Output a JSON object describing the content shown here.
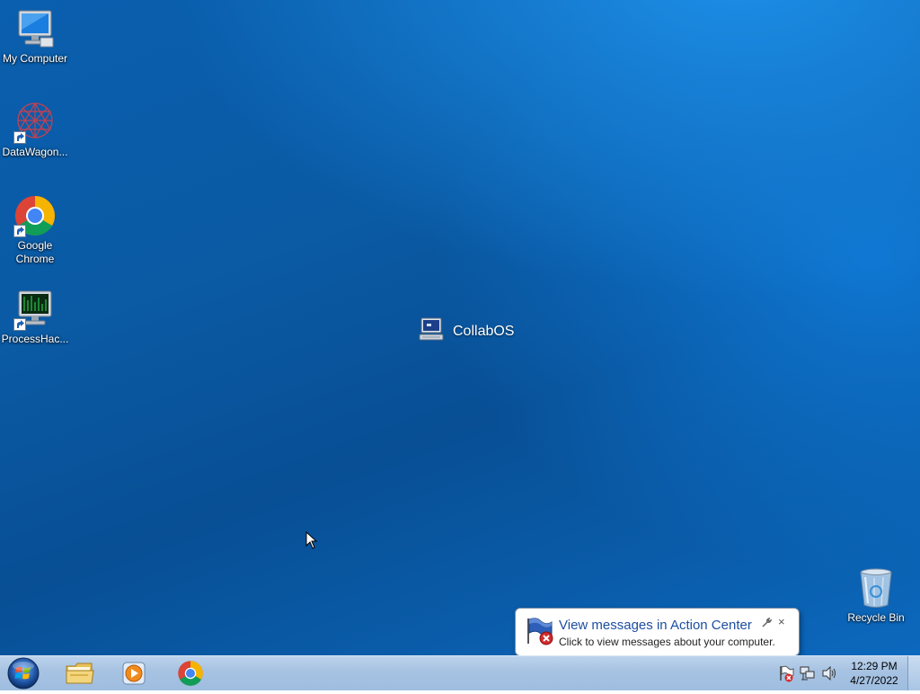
{
  "desktop": {
    "icons": [
      {
        "label": "My Computer",
        "icon": "computer-icon"
      },
      {
        "label": "DataWagon...",
        "icon": "datawagon-icon"
      },
      {
        "label": "Google Chrome",
        "icon": "chrome-icon"
      },
      {
        "label": "ProcessHac...",
        "icon": "processhacker-icon"
      }
    ],
    "recycle_bin": {
      "label": "Recycle Bin",
      "icon": "recycle-bin-icon"
    },
    "watermark": {
      "label": "CollabOS",
      "icon": "collabos-icon"
    }
  },
  "notification": {
    "title": "View messages in Action Center",
    "subtitle": "Click to view messages about your computer.",
    "close_label": "×",
    "icon": "action-center-flag-icon"
  },
  "taskbar": {
    "start": {
      "icon": "start-orb-icon"
    },
    "pinned": [
      {
        "name": "file-explorer",
        "icon": "folder-icon"
      },
      {
        "name": "media-player",
        "icon": "media-player-icon"
      },
      {
        "name": "chrome",
        "icon": "chrome-icon"
      }
    ],
    "tray": [
      {
        "name": "action-center",
        "icon": "action-center-flag-icon"
      },
      {
        "name": "network",
        "icon": "network-icon"
      },
      {
        "name": "volume",
        "icon": "volume-icon"
      }
    ],
    "clock": {
      "time": "12:29 PM",
      "date": "4/27/2022"
    }
  },
  "colors": {
    "desktop_bg": "#0a5aa4",
    "taskbar_bg": "#a8c3e2",
    "balloon_title": "#1e4fa0",
    "error_red": "#d22b2b"
  }
}
